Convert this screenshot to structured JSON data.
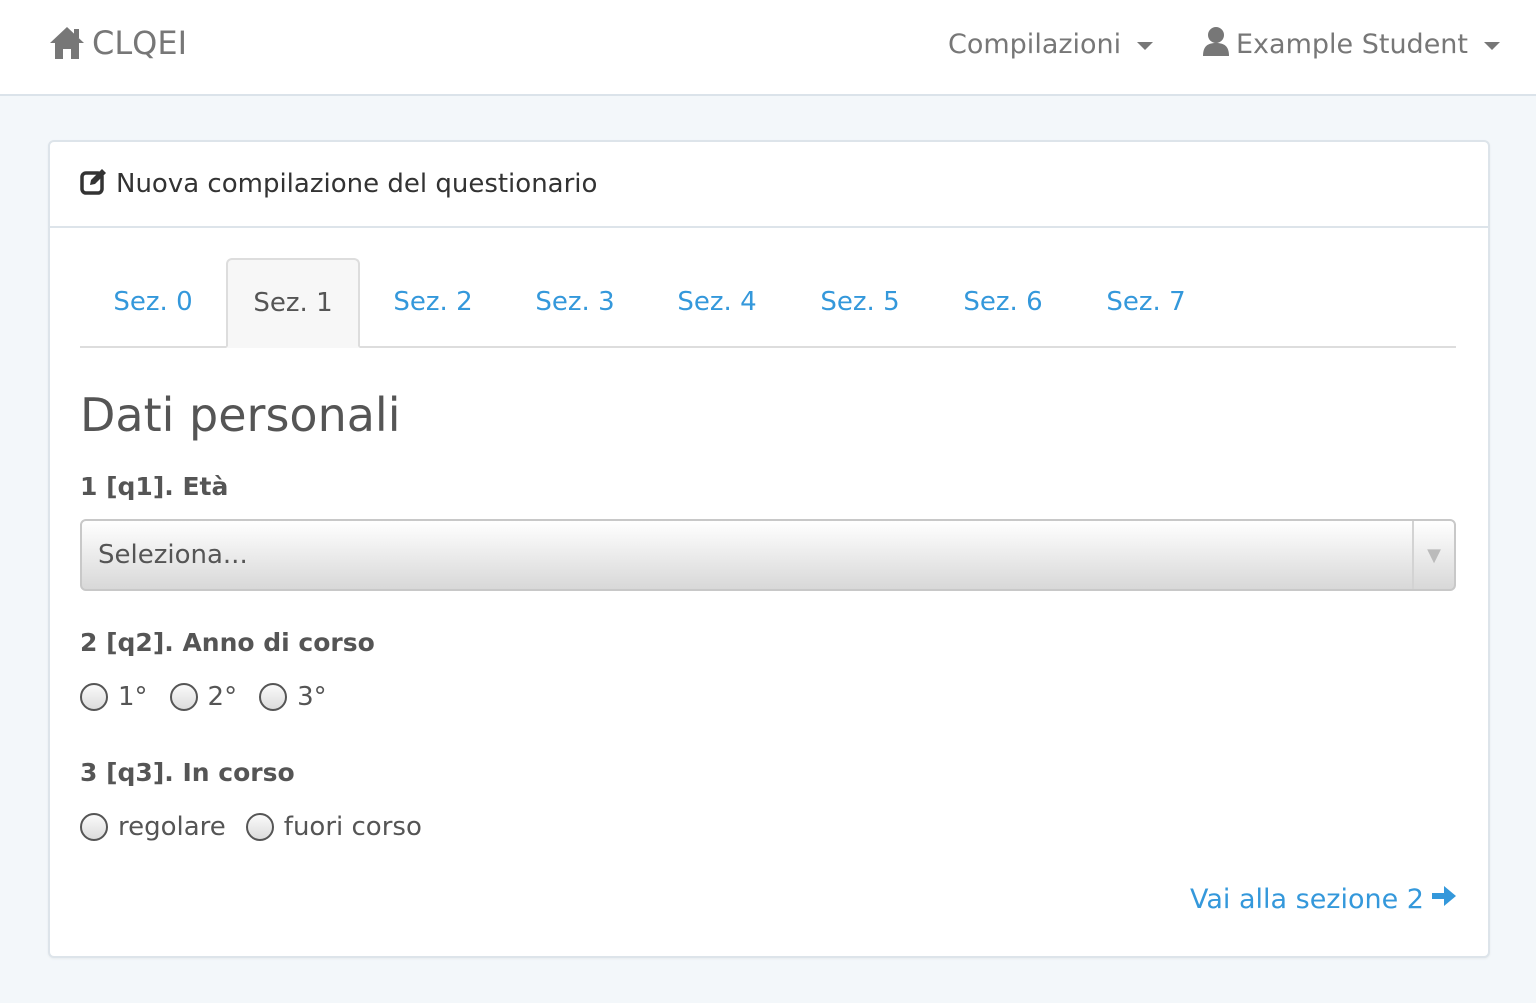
{
  "navbar": {
    "brand": "CLQEI",
    "menu_label": "Compilazioni",
    "user_label": "Example Student",
    "icons": {
      "brand": "home-icon",
      "user": "user-icon"
    }
  },
  "panel": {
    "heading": "Nuova compilazione del questionario",
    "heading_icon": "edit-icon"
  },
  "tabs": [
    "Sez. 0",
    "Sez. 1",
    "Sez. 2",
    "Sez. 3",
    "Sez. 4",
    "Sez. 5",
    "Sez. 6",
    "Sez. 7"
  ],
  "active_tab": "Sez. 1",
  "section": {
    "title": "Dati personali",
    "questions": [
      {
        "label": "1 [q1]. Età",
        "type": "select",
        "placeholder": "Seleziona..."
      },
      {
        "label": "2 [q2]. Anno di corso",
        "type": "radio",
        "options": [
          "1°",
          "2°",
          "3°"
        ]
      },
      {
        "label": "3 [q3]. In corso",
        "type": "radio",
        "options": [
          "regolare",
          "fuori corso"
        ]
      }
    ]
  },
  "next_link": "Vai alla sezione 2",
  "colors": {
    "link": "#3498db",
    "background": "#f3f7fa",
    "text": "#555555"
  }
}
